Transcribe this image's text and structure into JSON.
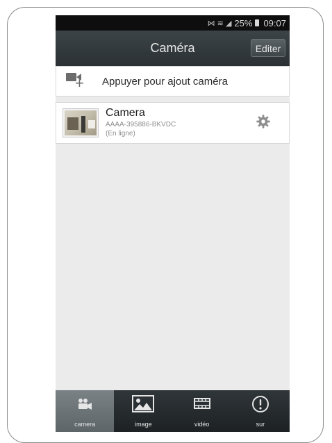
{
  "status_bar": {
    "signal_icons": "⋈ ≋ ◢",
    "battery_percent": "25%",
    "time": "09:07"
  },
  "header": {
    "title": "Caméra",
    "edit_label": "Editer"
  },
  "add_camera": {
    "label": "Appuyer pour ajout caméra",
    "icon": "camera-add-icon"
  },
  "cameras": [
    {
      "name": "Camera",
      "id": "AAAA-395886-BKVDC",
      "status": "(En ligne)",
      "settings_icon": "gear-icon"
    }
  ],
  "tabs": [
    {
      "label": "camera",
      "icon": "camera-tab-icon",
      "active": true
    },
    {
      "label": "image",
      "icon": "image-tab-icon",
      "active": false
    },
    {
      "label": "vidéo",
      "icon": "video-tab-icon",
      "active": false
    },
    {
      "label": "sur",
      "icon": "info-tab-icon",
      "active": false
    }
  ],
  "colors": {
    "status_bar": "#0e0e0e",
    "title_bar": "#2f3639",
    "content_bg": "#ebebeb",
    "active_tab": "#6b7377"
  }
}
